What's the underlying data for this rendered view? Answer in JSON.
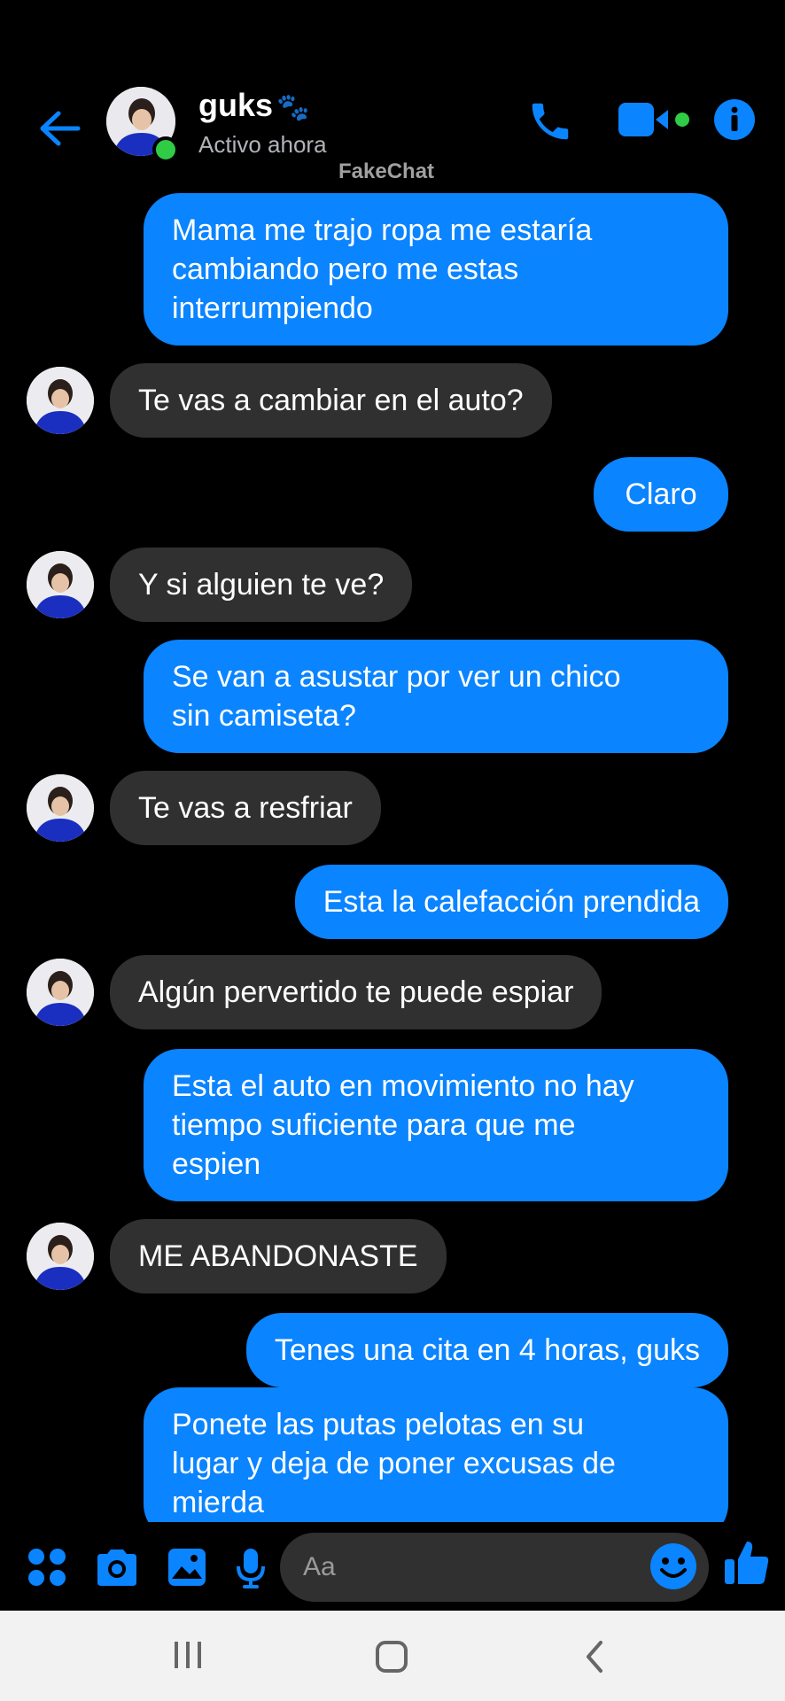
{
  "header": {
    "contact_name": "guks",
    "paw_glyph": "🐾",
    "status": "Activo ahora",
    "watermark": "FakeChat",
    "icons": [
      "back-arrow-icon",
      "phone-icon",
      "video-icon",
      "info-icon"
    ]
  },
  "messages": [
    {
      "side": "out",
      "text": "Mama me trajo ropa me estaría\ncambiando pero me estas\ninterrumpiendo"
    },
    {
      "side": "in",
      "text": "Te vas a cambiar en el auto?"
    },
    {
      "side": "out",
      "text": "Claro"
    },
    {
      "side": "in",
      "text": "Y si alguien te ve?"
    },
    {
      "side": "out",
      "text": "Se van a asustar por ver un chico\nsin camiseta?"
    },
    {
      "side": "in",
      "text": "Te vas a resfriar"
    },
    {
      "side": "out",
      "text": "Esta la calefacción prendida"
    },
    {
      "side": "in",
      "text": "Algún pervertido te puede espiar"
    },
    {
      "side": "out",
      "text": "Esta el auto en movimiento no hay\ntiempo suficiente para que me\nespien"
    },
    {
      "side": "in",
      "text": "ME ABANDONASTE"
    },
    {
      "side": "out",
      "text": "Tenes una cita en 4 horas, guks"
    },
    {
      "side": "out",
      "text": "Ponete las putas pelotas en su\nlugar y deja de poner excusas de\nmierda"
    }
  ],
  "composer": {
    "placeholder": "Aa",
    "icons": [
      "apps-icon",
      "camera-icon",
      "gallery-icon",
      "mic-icon",
      "emoji-icon",
      "like-icon"
    ]
  },
  "colors": {
    "accent": "#0a84ff",
    "incoming": "#303030",
    "online": "#31cc46",
    "background": "#000000"
  }
}
